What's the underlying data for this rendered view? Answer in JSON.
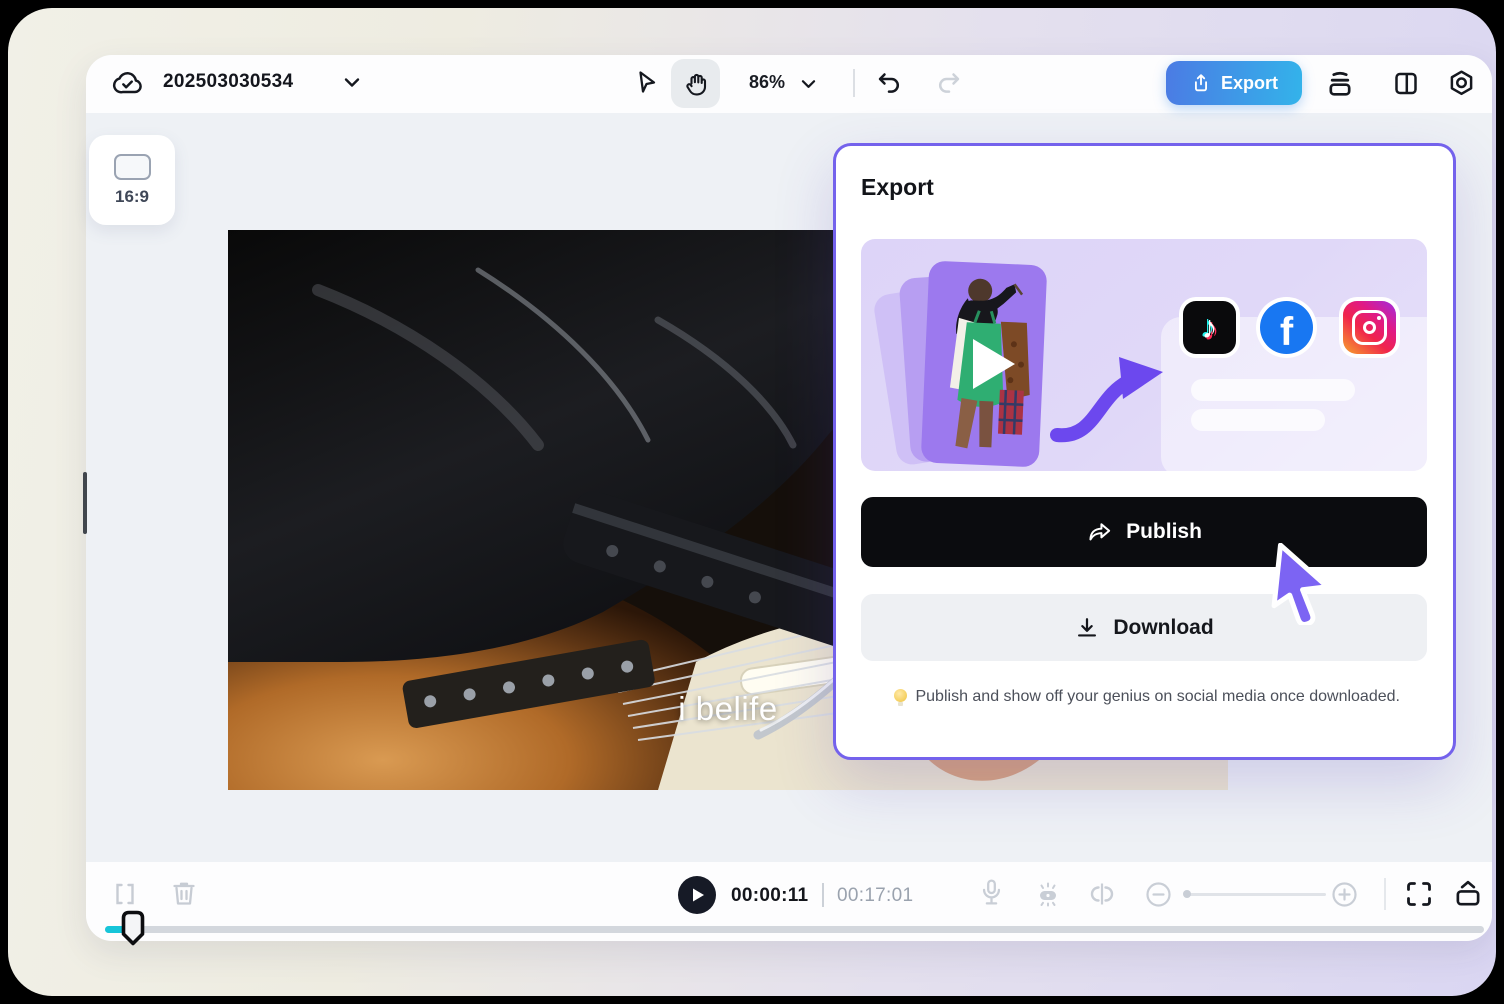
{
  "header": {
    "project_title": "202503030534",
    "zoom_level": "86%",
    "export_label": "Export"
  },
  "canvas": {
    "aspect_badge": "16:9",
    "caption": "i belife"
  },
  "dialog": {
    "title": "Export",
    "publish_label": "Publish",
    "download_label": "Download",
    "tip": "Publish and show off your genius on social media once downloaded.",
    "social_platforms": [
      "tiktok",
      "facebook",
      "instagram"
    ],
    "tiktok_glyph": "♪",
    "facebook_glyph": "f"
  },
  "timeline": {
    "current_time": "00:00:11",
    "total_duration": "00:17:01"
  },
  "colors": {
    "export_button_gradient_start": "#4b7be4",
    "export_button_gradient_end": "#33b3ea",
    "dialog_border": "#7462ec",
    "cursor_purple": "#7c64f3",
    "progress_cyan": "#17c5d9",
    "publish_black": "#0b0c0f",
    "facebook_blue": "#1877f2",
    "banner_lavender": "#ddd4f8"
  },
  "icons": [
    "cloud-sync-icon",
    "chevron-down-icon",
    "select-tool-icon",
    "hand-tool-icon",
    "undo-icon",
    "redo-icon",
    "upload-icon",
    "tracks-icon",
    "split-view-icon",
    "settings-icon",
    "aspect-ratio-icon",
    "share-forward-icon",
    "download-icon",
    "lightbulb-icon",
    "tiktok-icon",
    "facebook-icon",
    "instagram-icon",
    "play-overlay-icon",
    "trim-icon",
    "trash-icon",
    "play-icon",
    "mic-icon",
    "voice-effect-icon",
    "split-clip-icon",
    "zoom-out-icon",
    "zoom-in-icon",
    "fullscreen-icon",
    "export-frame-icon",
    "pointer-cursor-icon"
  ]
}
